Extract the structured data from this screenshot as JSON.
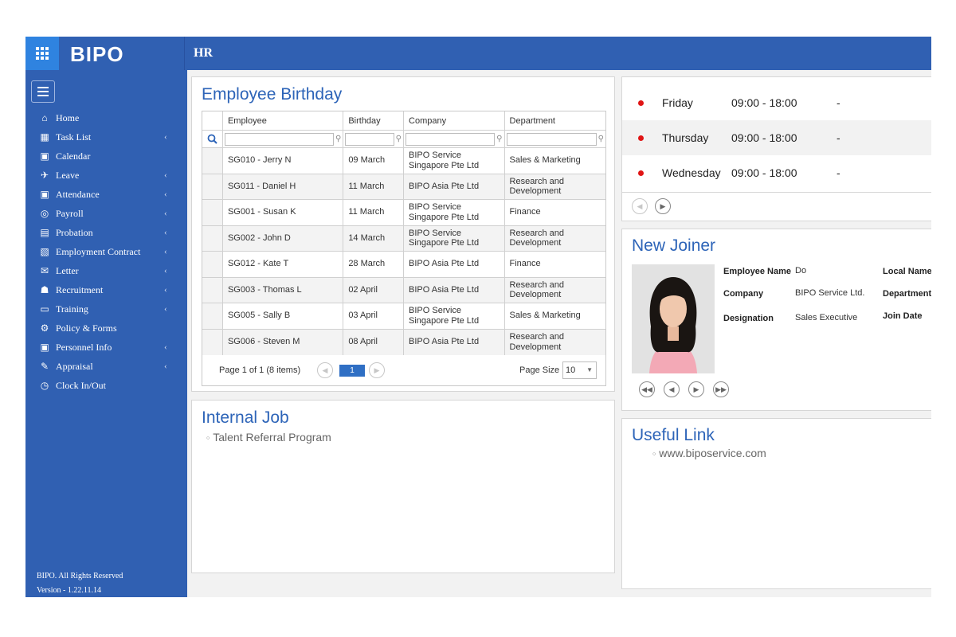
{
  "header": {
    "logo": "BIPO",
    "module": "HR"
  },
  "sidebar": {
    "items": [
      {
        "label": "Home",
        "icon": "home-icon",
        "glyph": "⌂",
        "chevron": false
      },
      {
        "label": "Task List",
        "icon": "task-list-icon",
        "glyph": "▦",
        "chevron": true
      },
      {
        "label": "Calendar",
        "icon": "calendar-icon",
        "glyph": "▣",
        "chevron": false
      },
      {
        "label": "Leave",
        "icon": "plane-icon",
        "glyph": "✈",
        "chevron": true
      },
      {
        "label": "Attendance",
        "icon": "attendance-icon",
        "glyph": "▣",
        "chevron": true
      },
      {
        "label": "Payroll",
        "icon": "payroll-icon",
        "glyph": "◎",
        "chevron": true
      },
      {
        "label": "Probation",
        "icon": "probation-icon",
        "glyph": "▤",
        "chevron": true
      },
      {
        "label": "Employment Contract",
        "icon": "contract-icon",
        "glyph": "▧",
        "chevron": true
      },
      {
        "label": "Letter",
        "icon": "letter-icon",
        "glyph": "✉",
        "chevron": true
      },
      {
        "label": "Recruitment",
        "icon": "recruitment-icon",
        "glyph": "☗",
        "chevron": true
      },
      {
        "label": "Training",
        "icon": "training-icon",
        "glyph": "▭",
        "chevron": true
      },
      {
        "label": "Policy & Forms",
        "icon": "policy-icon",
        "glyph": "⚙",
        "chevron": false
      },
      {
        "label": "Personnel Info",
        "icon": "personnel-icon",
        "glyph": "▣",
        "chevron": true
      },
      {
        "label": "Appraisal",
        "icon": "appraisal-icon",
        "glyph": "✎",
        "chevron": true
      },
      {
        "label": "Clock In/Out",
        "icon": "clock-icon",
        "glyph": "◷",
        "chevron": false
      }
    ],
    "footer_rights": "BIPO. All Rights Reserved",
    "footer_version": "Version - 1.22.11.14"
  },
  "birthday": {
    "title": "Employee Birthday",
    "columns": [
      "Employee",
      "Birthday",
      "Company",
      "Department"
    ],
    "rows": [
      [
        "SG010 - Jerry N",
        "09 March",
        "BIPO Service Singapore Pte Ltd",
        "Sales & Marketing"
      ],
      [
        "SG011 - Daniel H",
        "11 March",
        "BIPO Asia Pte Ltd",
        "Research and Development"
      ],
      [
        "SG001 - Susan K",
        "11 March",
        "BIPO Service Singapore Pte Ltd",
        "Finance"
      ],
      [
        "SG002 - John D",
        "14 March",
        "BIPO Service Singapore Pte Ltd",
        "Research and Development"
      ],
      [
        "SG012 - Kate T",
        "28 March",
        "BIPO Asia Pte Ltd",
        "Finance"
      ],
      [
        "SG003 - Thomas L",
        "02 April",
        "BIPO Asia Pte Ltd",
        "Research and Development"
      ],
      [
        "SG005 - Sally B",
        "03 April",
        "BIPO Service Singapore Pte Ltd",
        "Sales & Marketing"
      ],
      [
        "SG006 - Steven M",
        "08 April",
        "BIPO Asia Pte Ltd",
        "Research and Development"
      ]
    ],
    "pager_text": "Page 1 of 1 (8 items)",
    "current_page": "1",
    "page_size_label": "Page Size",
    "page_size": "10"
  },
  "internal_job": {
    "title": "Internal Job",
    "items": [
      "Talent Referral Program"
    ]
  },
  "schedule": {
    "rows": [
      {
        "day": "Friday",
        "time": "09:00 - 18:00",
        "note": "-"
      },
      {
        "day": "Thursday",
        "time": "09:00 - 18:00",
        "note": "-"
      },
      {
        "day": "Wednesday",
        "time": "09:00 - 18:00",
        "note": "-"
      }
    ],
    "dot_color": "#e01414"
  },
  "new_joiner": {
    "title": "New Joiner",
    "employee_name_label": "Employee Name",
    "employee_name": "Do",
    "local_name_label": "Local Name",
    "company_label": "Company",
    "company": "BIPO Service Ltd.",
    "department_label": "Department",
    "designation_label": "Designation",
    "designation": "Sales Executive",
    "join_date_label": "Join Date"
  },
  "useful_link": {
    "title": "Useful Link",
    "items": [
      "www.biposervice.com"
    ]
  },
  "colors": {
    "brand": "#3060b2",
    "title_blue": "#2d64b8",
    "accent": "#2f83e0"
  }
}
